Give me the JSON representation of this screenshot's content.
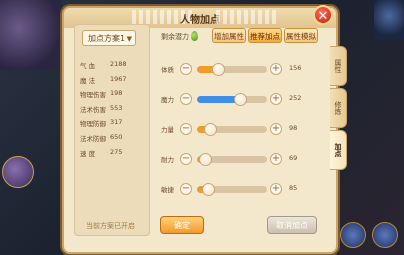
{
  "title": "人物加点",
  "close_icon": "close-icon",
  "scheme": {
    "selected": "加点方案1",
    "dropdown_icon": "chevron-down-icon"
  },
  "stats": [
    {
      "label": "气    血",
      "value": "2188"
    },
    {
      "label": "魔    法",
      "value": "1967"
    },
    {
      "label": "物理伤害",
      "value": "198"
    },
    {
      "label": "法术伤害",
      "value": "553"
    },
    {
      "label": "物理防御",
      "value": "317"
    },
    {
      "label": "法术防御",
      "value": "650"
    },
    {
      "label": "速    度",
      "value": "275"
    }
  ],
  "status_text": "当前方案已开启",
  "remain_label": "剩余潜力",
  "tabs": [
    {
      "label": "增加属性",
      "active": false
    },
    {
      "label": "推荐加点",
      "active": true
    },
    {
      "label": "属性模拟",
      "active": false
    }
  ],
  "attributes": [
    {
      "label": "体质",
      "value": "156",
      "fill_fraction": 0.3,
      "color": "#f29a2c"
    },
    {
      "label": "魔力",
      "value": "252",
      "fill_fraction": 0.62,
      "color": "#3f8ee8"
    },
    {
      "label": "力量",
      "value": "98",
      "fill_fraction": 0.18,
      "color": "#f29a2c"
    },
    {
      "label": "耐力",
      "value": "69",
      "fill_fraction": 0.12,
      "color": "#f29a2c"
    },
    {
      "label": "敏捷",
      "value": "85",
      "fill_fraction": 0.15,
      "color": "#f29a2c"
    }
  ],
  "minus_symbol": "−",
  "plus_symbol": "+",
  "buttons": {
    "confirm": "确定",
    "cancel": "取消加点"
  },
  "side_tabs": [
    {
      "label": "属性",
      "active": false
    },
    {
      "label": "修炼",
      "active": false
    },
    {
      "label": "加点",
      "active": true
    }
  ],
  "colors": {
    "accent": "#f29a2c",
    "panel_bg": "#f3e7cc",
    "close_red": "#d62a1a",
    "magic_blue": "#3f8ee8"
  }
}
